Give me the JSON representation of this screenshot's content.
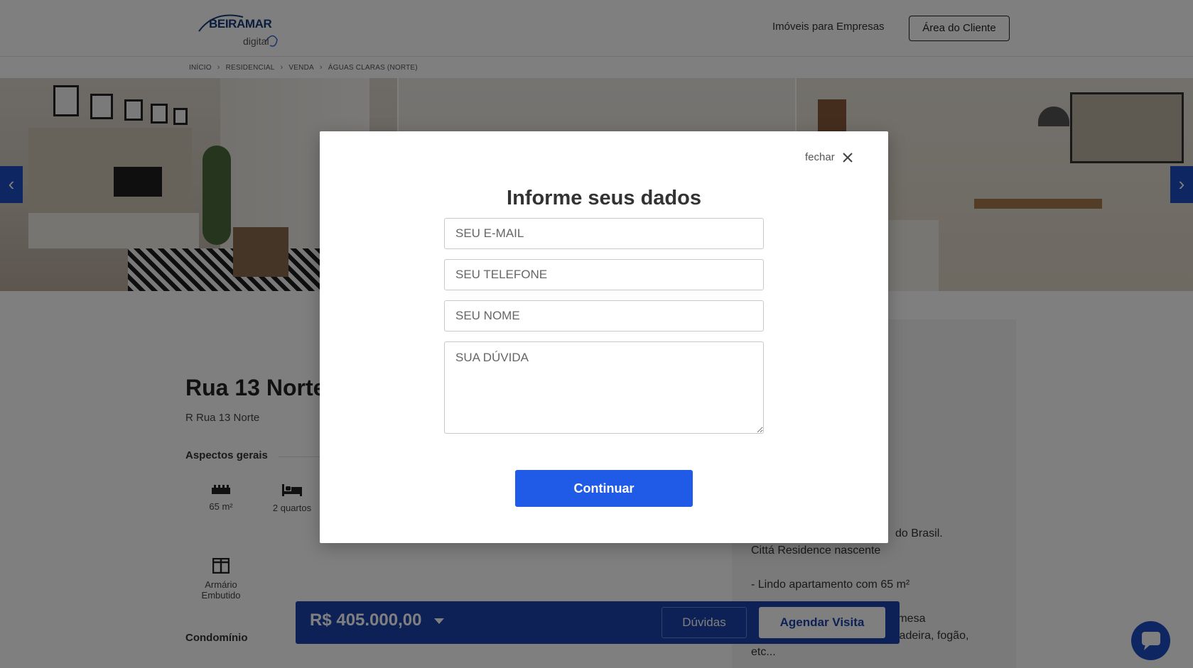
{
  "header": {
    "logo_brand": "BEIRAMAR",
    "logo_sub": "digital",
    "nav_link": "Imóveis para Empresas",
    "client_button": "Área do Cliente"
  },
  "breadcrumb": [
    "INÍCIO",
    "RESIDENCIAL",
    "VENDA",
    "ÁGUAS CLARAS (NORTE)"
  ],
  "property": {
    "title": "Rua 13 Norte",
    "address": "R Rua 13 Norte",
    "general_title": "Aspectos gerais",
    "features": [
      {
        "icon": "ruler-icon",
        "label": "65 m²"
      },
      {
        "icon": "bed-icon",
        "label": "2 quartos"
      },
      {
        "icon": "wardrobe-icon",
        "label": "Armário Embutido"
      }
    ],
    "condominium_title": "Condomínio"
  },
  "description": {
    "line1": "do Brasil.",
    "line2": "Cittá Residence nascente",
    "line3": "- Lindo apartamento com 65 m²",
    "line4": "á,mesa",
    "line5": "ladeira, fogão,",
    "line6": "etc..."
  },
  "price_bar": {
    "price": "R$ 405.000,00",
    "questions_button": "Dúvidas",
    "schedule_button": "Agendar Visita"
  },
  "modal": {
    "close_label": "fechar",
    "title": "Informe seus dados",
    "email_placeholder": "SEU E-MAIL",
    "phone_placeholder": "SEU TELEFONE",
    "name_placeholder": "SEU NOME",
    "question_placeholder": "SUA DÚVIDA",
    "submit": "Continuar"
  },
  "colors": {
    "brand_blue": "#1d4fc7",
    "price_bar": "#1a43ad",
    "submit_button": "#1f5be6",
    "overlay": "rgba(0,0,0,0.5)"
  }
}
